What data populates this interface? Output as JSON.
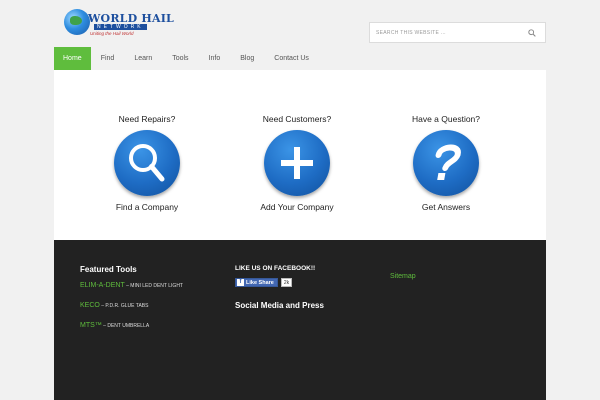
{
  "header": {
    "logo": {
      "brand": "WORLD HAIL",
      "brand2": "NETWORK",
      "tagline": "Uniting the Hail World"
    },
    "search": {
      "placeholder": "SEARCH THIS WEBSITE ..."
    }
  },
  "nav": {
    "items": [
      {
        "label": "Home",
        "active": true
      },
      {
        "label": "Find"
      },
      {
        "label": "Learn"
      },
      {
        "label": "Tools"
      },
      {
        "label": "Info"
      },
      {
        "label": "Blog"
      },
      {
        "label": "Contact Us"
      }
    ]
  },
  "main": {
    "ctas": [
      {
        "title": "Need Repairs?",
        "icon": "magnifier-icon",
        "caption": "Find a Company"
      },
      {
        "title": "Need Customers?",
        "icon": "plus-icon",
        "caption": "Add Your Company"
      },
      {
        "title": "Have a Question?",
        "icon": "question-icon",
        "caption": "Get Answers"
      }
    ]
  },
  "footer": {
    "featured": {
      "heading": "Featured Tools",
      "tools": [
        {
          "name": "ELIM-A-DENT",
          "desc": " – MINI LED DENT LIGHT"
        },
        {
          "name": "KECO",
          "desc": " – P.D.R. GLUE TABS"
        },
        {
          "name": "MTS™",
          "desc": " – DENT UMBRELLA"
        }
      ]
    },
    "facebook": {
      "heading": "LIKE US ON FACEBOOK!!",
      "button": "Like",
      "share": "Share",
      "count": "2k"
    },
    "social": {
      "heading": "Social Media and Press"
    },
    "sitemap": "Sitemap"
  },
  "colors": {
    "accent": "#5fbd3d",
    "footer_bg": "#222222",
    "cta_blue": "#1e6cc4"
  }
}
